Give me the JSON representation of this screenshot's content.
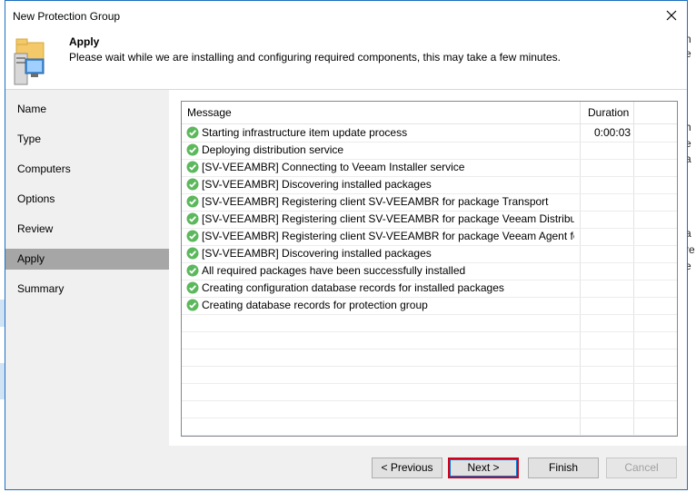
{
  "window": {
    "title": "New Protection Group"
  },
  "header": {
    "title": "Apply",
    "description": "Please wait while we are installing and configuring required components, this may take a few minutes."
  },
  "steps": [
    "Name",
    "Type",
    "Computers",
    "Options",
    "Review",
    "Apply",
    "Summary"
  ],
  "active_step": "Apply",
  "grid": {
    "columns": {
      "message": "Message",
      "duration": "Duration"
    },
    "rows": [
      {
        "message": "Starting infrastructure item update process",
        "duration": "0:00:03"
      },
      {
        "message": "Deploying distribution service",
        "duration": ""
      },
      {
        "message": "[SV-VEEAMBR] Connecting to Veeam Installer service",
        "duration": ""
      },
      {
        "message": "[SV-VEEAMBR] Discovering installed packages",
        "duration": ""
      },
      {
        "message": "[SV-VEEAMBR] Registering client SV-VEEAMBR for package Transport",
        "duration": ""
      },
      {
        "message": "[SV-VEEAMBR] Registering client SV-VEEAMBR for package Veeam Distributi...",
        "duration": ""
      },
      {
        "message": "[SV-VEEAMBR] Registering client SV-VEEAMBR for package Veeam Agent for...",
        "duration": ""
      },
      {
        "message": "[SV-VEEAMBR] Discovering installed packages",
        "duration": ""
      },
      {
        "message": "All required packages have been successfully installed",
        "duration": ""
      },
      {
        "message": "Creating configuration database records for installed packages",
        "duration": ""
      },
      {
        "message": "Creating database records for protection group",
        "duration": ""
      }
    ],
    "status_color": "#5cb85c"
  },
  "buttons": {
    "previous": "< Previous",
    "next": "Next >",
    "finish": "Finish",
    "cancel": "Cancel"
  },
  "background_fragments": [
    "n",
    "e",
    "h",
    "e",
    "a",
    "a",
    "re",
    "e"
  ]
}
